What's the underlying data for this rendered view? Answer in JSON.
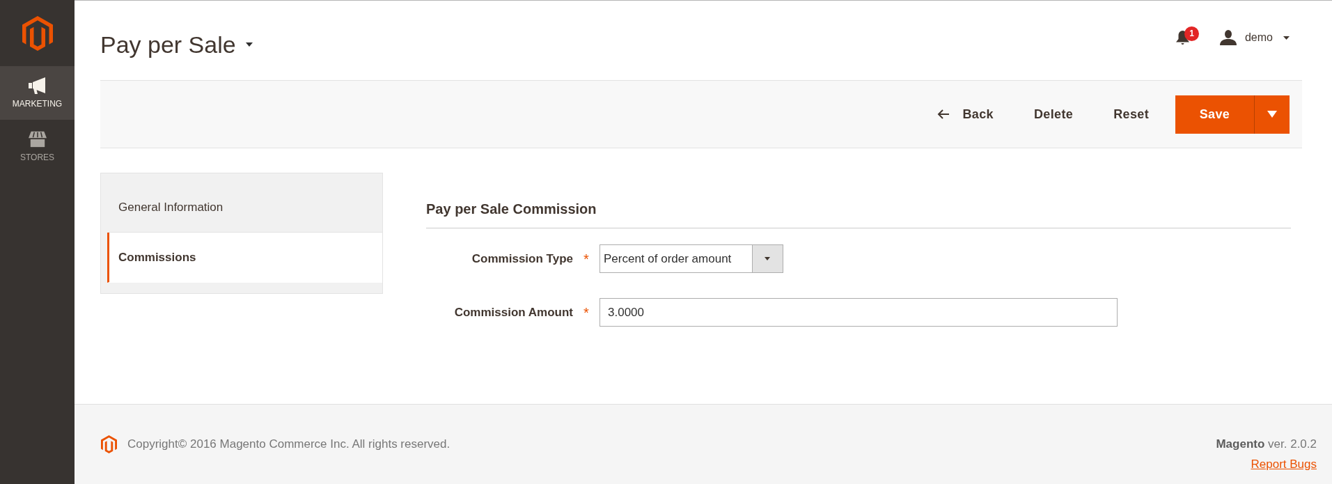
{
  "sidebar": {
    "items": [
      {
        "label": "MARKETING",
        "kind": "megaphone",
        "selected": true
      },
      {
        "label": "STORES",
        "kind": "store",
        "selected": false
      }
    ]
  },
  "header": {
    "title": "Pay per Sale",
    "notifications": "1",
    "user": "demo"
  },
  "toolbar": {
    "buttons": [
      {
        "label": "Back",
        "kind": "back"
      },
      {
        "label": "Delete",
        "kind": "delete"
      },
      {
        "label": "Reset",
        "kind": "reset"
      },
      {
        "label": "Save",
        "kind": "save"
      }
    ]
  },
  "tabs": [
    {
      "label": "General Information",
      "selected": false
    },
    {
      "label": "Commissions",
      "selected": true
    }
  ],
  "section": {
    "title": "Pay per Sale Commission",
    "fields": [
      {
        "label": "Commission Type",
        "required_mark": "*",
        "kind": "select",
        "value": "Percent of order amount"
      },
      {
        "label": "Commission Amount",
        "required_mark": "*",
        "kind": "text",
        "value": "3.0000"
      }
    ]
  },
  "footer": {
    "copyright": "Copyright© 2016 Magento Commerce Inc. All rights reserved.",
    "version": "**Magento** ver. 2.0.2",
    "link": "Report Bugs"
  }
}
